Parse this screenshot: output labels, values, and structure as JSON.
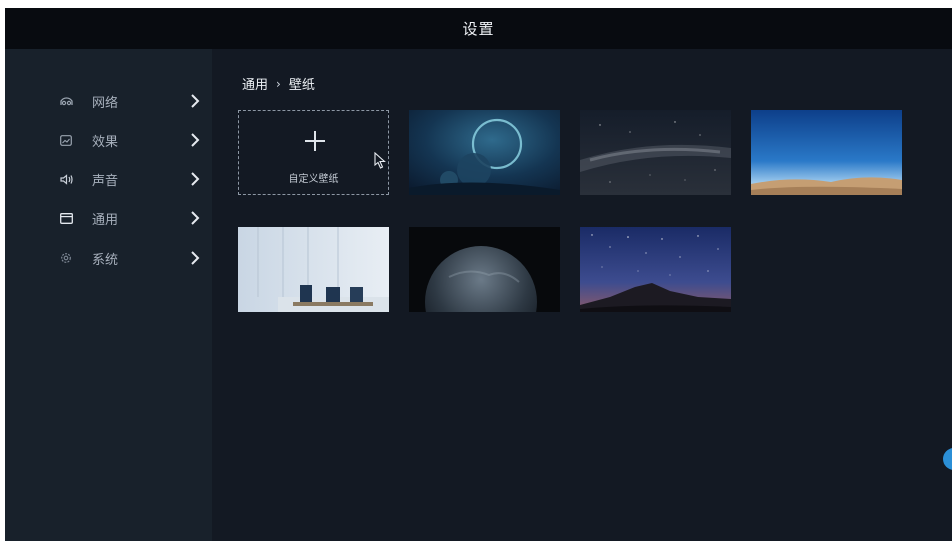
{
  "window": {
    "title": "设置"
  },
  "sidebar": {
    "items": [
      {
        "label": "网络",
        "icon": "network-icon"
      },
      {
        "label": "效果",
        "icon": "image-effect-icon"
      },
      {
        "label": "声音",
        "icon": "speaker-icon"
      },
      {
        "label": "通用",
        "icon": "window-icon"
      },
      {
        "label": "系统",
        "icon": "gear-icon"
      }
    ]
  },
  "breadcrumb": {
    "parent": "通用",
    "separator": "›",
    "current": "壁纸"
  },
  "wallpapers": {
    "custom_label": "自定义壁纸",
    "items": [
      {
        "name": "planet-ring-wallpaper"
      },
      {
        "name": "milky-way-wallpaper"
      },
      {
        "name": "desert-blue-sky-wallpaper"
      },
      {
        "name": "meeting-room-wallpaper"
      },
      {
        "name": "earth-dark-wallpaper"
      },
      {
        "name": "starry-mountain-wallpaper"
      }
    ]
  },
  "colors": {
    "background": "#131923",
    "sidebar": "#18212b",
    "topbar": "#080b10",
    "accent": "#2b8fd6"
  }
}
